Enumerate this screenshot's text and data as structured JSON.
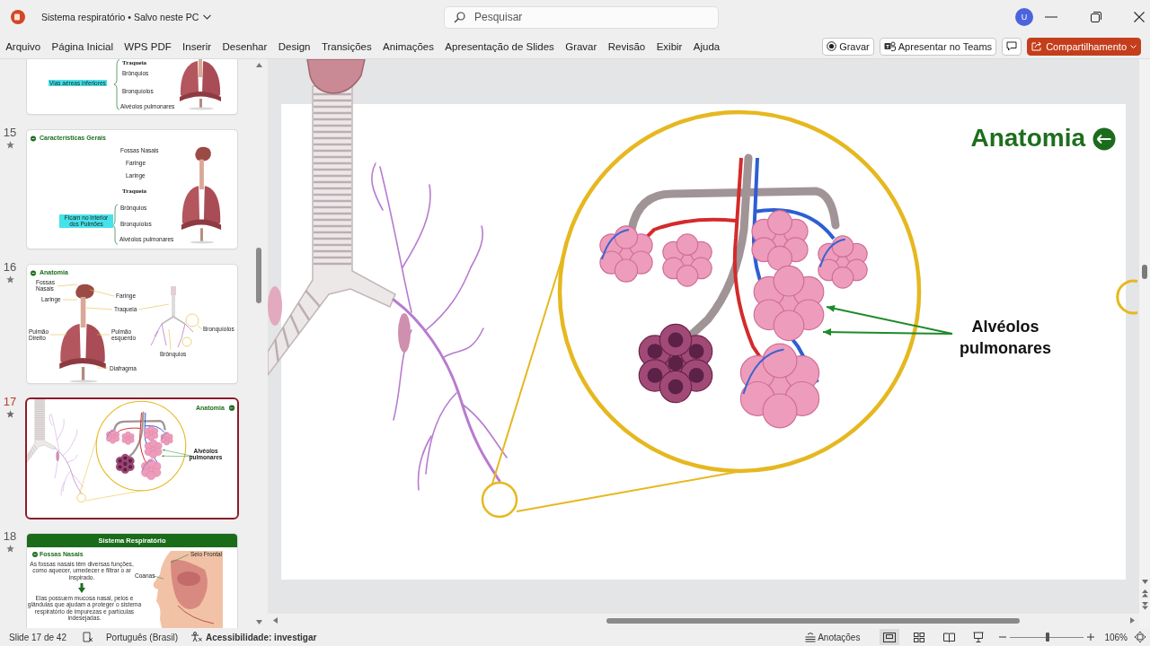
{
  "window": {
    "title": "Sistema respiratório • Salvo neste PC"
  },
  "search": {
    "placeholder": "Pesquisar"
  },
  "account": {
    "initial": "U"
  },
  "ribbon_tabs": [
    "Arquivo",
    "Página Inicial",
    "WPS PDF",
    "Inserir",
    "Desenhar",
    "Design",
    "Transições",
    "Animações",
    "Apresentação de Slides",
    "Gravar",
    "Revisão",
    "Exibir",
    "Ajuda"
  ],
  "ribbon_actions": [
    {
      "kind": "record",
      "label": "Gravar"
    },
    {
      "kind": "teams",
      "label": "Apresentar no Teams"
    },
    {
      "kind": "comments"
    },
    {
      "kind": "share",
      "label": "Compartilhamento"
    }
  ],
  "thumbnails": [
    {
      "selected": false,
      "kind": "brace-list-lower",
      "texts": [
        "Traqueia",
        "Brônquios",
        "Vias aéreas inferiores",
        "Bronquíolos",
        "Alvéolos pulmonares"
      ]
    },
    {
      "number": "15",
      "animated": true,
      "selected": false,
      "kind": "brace-list",
      "texts": [
        "Características Gerais",
        "Fossas Nasais",
        "Faringe",
        "Laringe",
        "Traqueia",
        "Ficam no interior dos Pulmões",
        "Brônquios",
        "Bronquíolos",
        "Alvéolos pulmonares"
      ]
    },
    {
      "number": "16",
      "animated": true,
      "selected": false,
      "kind": "labeled-anatomy",
      "texts": [
        "Anatomia",
        "Fossas Nasais",
        "Laringe",
        "Faringe",
        "Traqueia",
        "Pulmão Direito",
        "Pulmão esquerdo",
        "Bronquíolos",
        "Brônquios",
        "Diafragma"
      ]
    },
    {
      "number": "17",
      "animated": true,
      "selected": true,
      "kind": "zoom-detail",
      "texts": [
        "Anatomia",
        "Alvéolos pulmonares"
      ]
    },
    {
      "number": "18",
      "animated": true,
      "selected": false,
      "kind": "section-text",
      "texts": [
        "Sistema Respiratório",
        "Fossas Nasais",
        "As fossas nasais têm diversas funções, como aquecer, umedecer e filtrar o ar inspirado.",
        "Seio Frontal",
        "Coanas",
        "Elas possuem mucosa nasal, pelos e glândulas que ajudam a proteger o sistema respiratório de impurezas e partículas indesejadas."
      ]
    }
  ],
  "slide": {
    "title": "Anatomia",
    "label": "Alvéolos pulmonares"
  },
  "status_bar": {
    "slide_count": "Slide 17 de 42",
    "language": "Português (Brasil)",
    "accessibility": "Acessibilidade: investigar",
    "notes": "Anotações",
    "views": [
      {
        "kind": "normal",
        "selected": true
      },
      {
        "kind": "sorter",
        "selected": false
      },
      {
        "kind": "reading",
        "selected": false
      },
      {
        "kind": "slideshow",
        "selected": false
      }
    ],
    "zoom": {
      "level": 0.51,
      "reading": "106%"
    }
  }
}
